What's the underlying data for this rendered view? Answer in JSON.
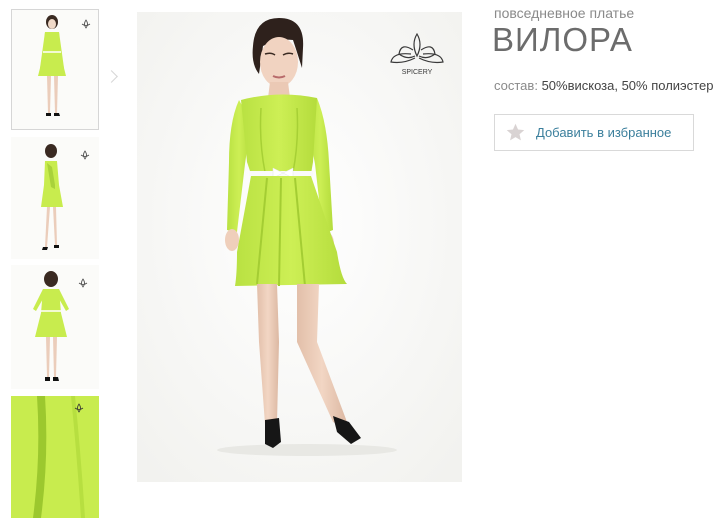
{
  "product": {
    "category": "повседневное платье",
    "name": "ВИЛОРА",
    "composition_label": "состав:",
    "composition_value": "50%вискоза, 50% полиэстер"
  },
  "actions": {
    "favorite_label": "Добавить в избранное"
  },
  "brand": {
    "logo_text": "SPICERY"
  },
  "gallery": {
    "thumbnails": [
      {
        "view": "front",
        "active": true
      },
      {
        "view": "side",
        "active": false
      },
      {
        "view": "back",
        "active": false
      },
      {
        "view": "fabric-detail",
        "active": false
      }
    ]
  },
  "colors": {
    "dress": "#c8ec4e",
    "dress_shadow": "#a9d23a",
    "star": "#d9d3d3",
    "link": "#3b7f9c"
  }
}
